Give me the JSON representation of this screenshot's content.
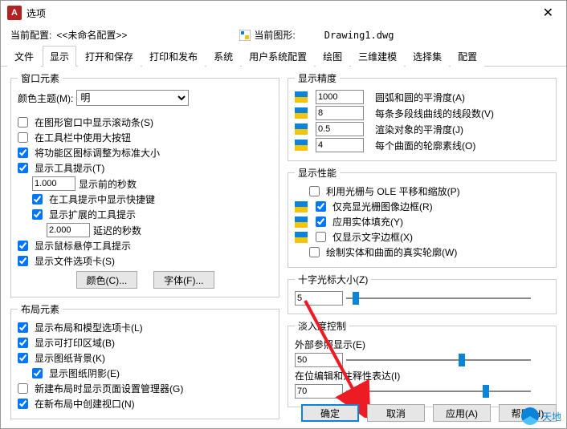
{
  "window": {
    "title": "选项"
  },
  "context": {
    "current_config_label": "当前配置:",
    "current_config_value": "<<未命名配置>>",
    "current_drawing_label": "当前图形:",
    "current_drawing_value": "Drawing1.dwg"
  },
  "tabs": {
    "file": "文件",
    "display": "显示",
    "open_save": "打开和保存",
    "print_publish": "打印和发布",
    "system": "系统",
    "user_sys": "用户系统配置",
    "draw": "绘图",
    "3d": "三维建模",
    "select": "选择集",
    "config": "配置"
  },
  "window_elements": {
    "legend": "窗口元素",
    "color_theme_label": "颜色主题(M):",
    "color_theme_value": "明",
    "show_scrollbar": "在图形窗口中显示滚动条(S)",
    "big_toolbar_btn": "在工具栏中使用大按钮",
    "ribbon_std_size": "将功能区图标调整为标准大小",
    "show_tooltip": "显示工具提示(T)",
    "tooltip_delay_val": "1.000",
    "tooltip_delay_lbl": "显示前的秒数",
    "show_shortcut": "在工具提示中显示快捷键",
    "show_ext_tooltip": "显示扩展的工具提示",
    "ext_tooltip_delay_val": "2.000",
    "ext_tooltip_delay_lbl": "延迟的秒数",
    "show_hover_tip": "显示鼠标悬停工具提示",
    "show_file_tab": "显示文件选项卡(S)",
    "btn_color": "颜色(C)...",
    "btn_font": "字体(F)..."
  },
  "layout_elements": {
    "legend": "布局元素",
    "show_layout_tabs": "显示布局和模型选项卡(L)",
    "show_print_area": "显示可打印区域(B)",
    "show_paper_bg": "显示图纸背景(K)",
    "show_paper_shadow": "显示图纸阴影(E)",
    "new_layout_pagesetup": "新建布局时显示页面设置管理器(G)",
    "create_vp_new_layout": "在新布局中创建视口(N)"
  },
  "display_precision": {
    "legend": "显示精度",
    "arc_smooth_val": "1000",
    "arc_smooth_lbl": "圆弧和圆的平滑度(A)",
    "polyline_seg_val": "8",
    "polyline_seg_lbl": "每条多段线曲线的线段数(V)",
    "render_smooth_val": "0.5",
    "render_smooth_lbl": "渲染对象的平滑度(J)",
    "surface_lines_val": "4",
    "surface_lines_lbl": "每个曲面的轮廓素线(O)"
  },
  "display_perf": {
    "legend": "显示性能",
    "raster_pan": "利用光栅与 OLE 平移和缩放(P)",
    "highlight_raster": "仅亮显光栅图像边框(R)",
    "solid_fill": "应用实体填充(Y)",
    "text_frame": "仅显示文字边框(X)",
    "draw_silhouette": "绘制实体和曲面的真实轮廓(W)"
  },
  "crosshair": {
    "legend": "十字光标大小(Z)",
    "value": "5"
  },
  "fade": {
    "legend": "淡入度控制",
    "xref_label": "外部参照显示(E)",
    "xref_value": "50",
    "inplace_label": "在位编辑和注释性表达(I)",
    "inplace_value": "70"
  },
  "footer": {
    "ok": "确定",
    "cancel": "取消",
    "apply": "应用(A)",
    "help": "帮助(H)"
  },
  "watermark": "天地"
}
